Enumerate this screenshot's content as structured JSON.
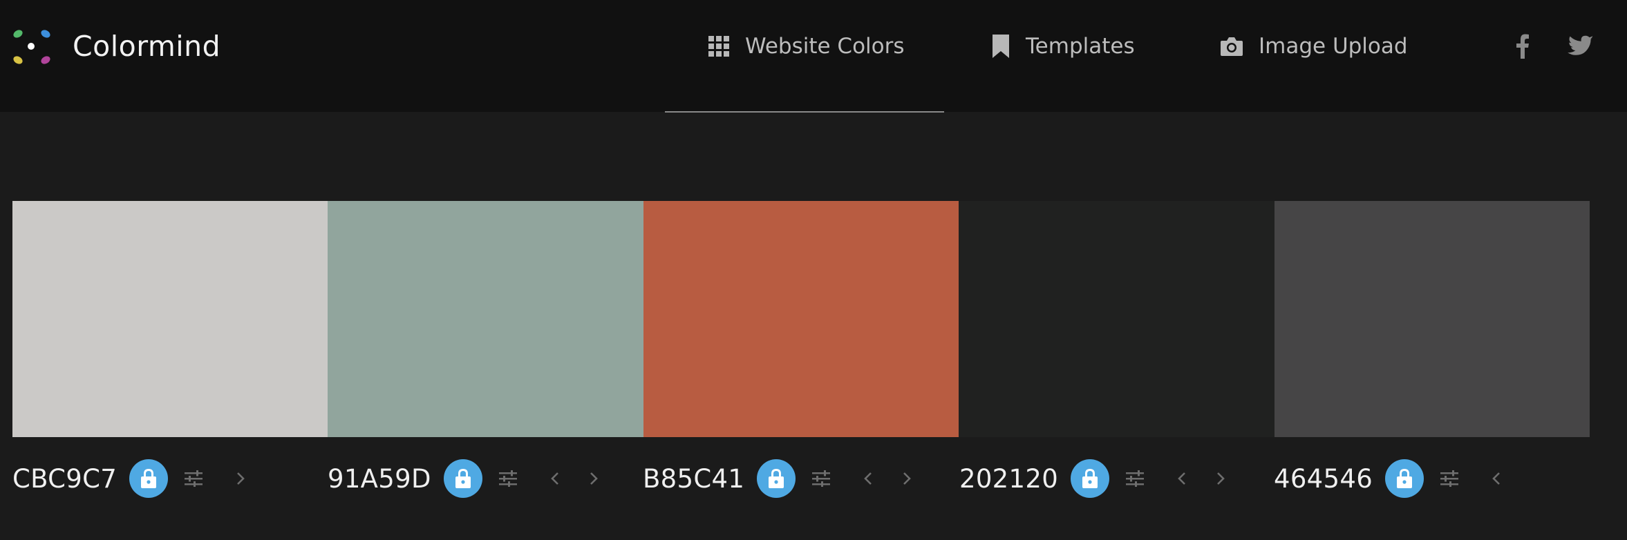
{
  "brand": {
    "name": "Colormind",
    "logo_colors": [
      "#53b96a",
      "#3d8fdc",
      "#ffffff",
      "#d8c244",
      "#b1449b"
    ]
  },
  "nav": {
    "items": [
      {
        "label": "Website Colors",
        "icon": "grid-icon",
        "active": true
      },
      {
        "label": "Templates",
        "icon": "bookmark-icon",
        "active": false
      },
      {
        "label": "Image Upload",
        "icon": "camera-icon",
        "active": false
      }
    ],
    "social": [
      "facebook-icon",
      "twitter-icon"
    ]
  },
  "palette": {
    "swatches": [
      {
        "hex": "CBC9C7",
        "color": "#CBC9C7",
        "locked": true,
        "prev": false,
        "next": true
      },
      {
        "hex": "91A59D",
        "color": "#91A59D",
        "locked": true,
        "prev": true,
        "next": true
      },
      {
        "hex": "B85C41",
        "color": "#B85C41",
        "locked": true,
        "prev": true,
        "next": true
      },
      {
        "hex": "202120",
        "color": "#202120",
        "locked": true,
        "prev": true,
        "next": true
      },
      {
        "hex": "464546",
        "color": "#464546",
        "locked": true,
        "prev": true,
        "next": false
      }
    ]
  },
  "colors": {
    "topbar": "#111111",
    "background": "#1b1b1b",
    "accent": "#4fa9e3"
  }
}
